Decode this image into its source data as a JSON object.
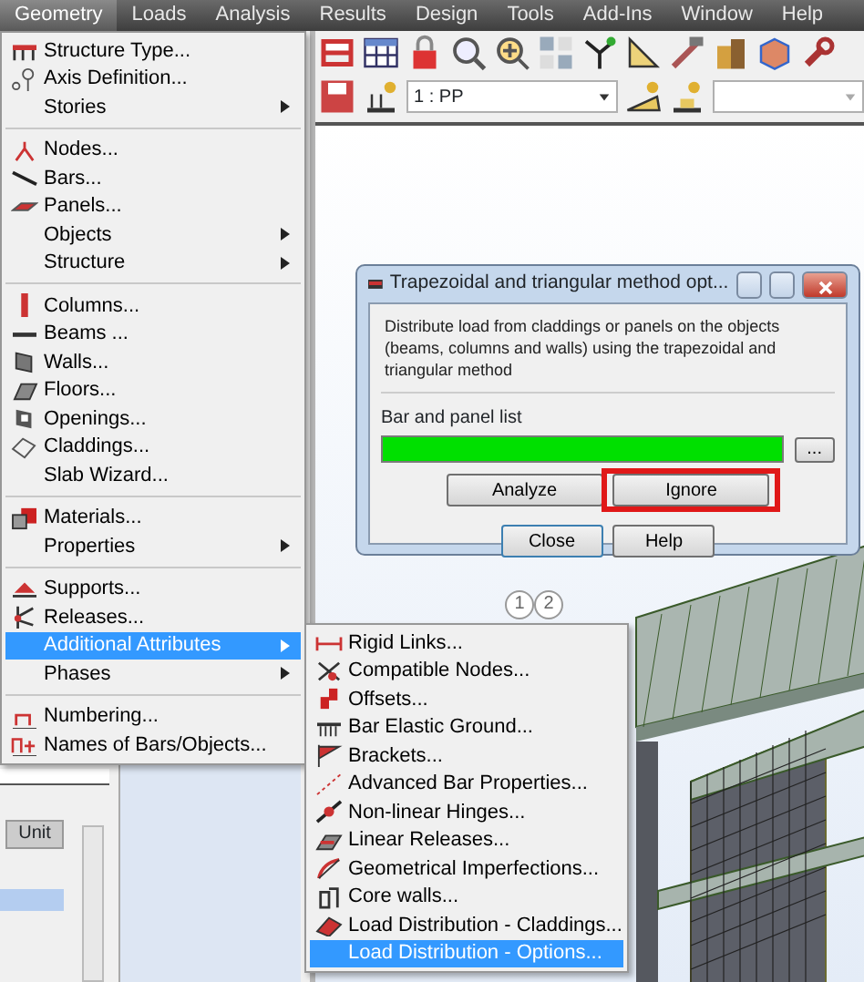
{
  "menubar": [
    {
      "label": "Geometry",
      "selected": true
    },
    {
      "label": "Loads",
      "selected": false
    },
    {
      "label": "Analysis",
      "selected": false
    },
    {
      "label": "Results",
      "selected": false
    },
    {
      "label": "Design",
      "selected": false
    },
    {
      "label": "Tools",
      "selected": false
    },
    {
      "label": "Add-Ins",
      "selected": false
    },
    {
      "label": "Window",
      "selected": false
    },
    {
      "label": "Help",
      "selected": false
    }
  ],
  "toolbar": {
    "case_select": {
      "value": "1 : PP"
    }
  },
  "grid_labels": [
    "1",
    "2"
  ],
  "bottom_panel": {
    "table": {
      "columns": [
        "Unit"
      ]
    }
  },
  "geometry_menu": {
    "items": [
      {
        "kind": "item",
        "label": "Structure Type...",
        "submenu": false,
        "selected": false
      },
      {
        "kind": "item",
        "label": "Axis Definition...",
        "submenu": false,
        "selected": false
      },
      {
        "kind": "item",
        "label": "Stories",
        "submenu": true,
        "selected": false
      },
      {
        "kind": "separator"
      },
      {
        "kind": "item",
        "label": "Nodes...",
        "submenu": false,
        "selected": false
      },
      {
        "kind": "item",
        "label": "Bars...",
        "submenu": false,
        "selected": false
      },
      {
        "kind": "item",
        "label": "Panels...",
        "submenu": false,
        "selected": false
      },
      {
        "kind": "item",
        "label": "Objects",
        "submenu": true,
        "selected": false
      },
      {
        "kind": "item",
        "label": "Structure",
        "submenu": true,
        "selected": false
      },
      {
        "kind": "separator"
      },
      {
        "kind": "item",
        "label": "Columns...",
        "submenu": false,
        "selected": false
      },
      {
        "kind": "item",
        "label": "Beams ...",
        "submenu": false,
        "selected": false
      },
      {
        "kind": "item",
        "label": "Walls...",
        "submenu": false,
        "selected": false
      },
      {
        "kind": "item",
        "label": "Floors...",
        "submenu": false,
        "selected": false
      },
      {
        "kind": "item",
        "label": "Openings...",
        "submenu": false,
        "selected": false
      },
      {
        "kind": "item",
        "label": "Claddings...",
        "submenu": false,
        "selected": false
      },
      {
        "kind": "item",
        "label": "Slab Wizard...",
        "submenu": false,
        "selected": false
      },
      {
        "kind": "separator"
      },
      {
        "kind": "item",
        "label": "Materials...",
        "submenu": false,
        "selected": false
      },
      {
        "kind": "item",
        "label": "Properties",
        "submenu": true,
        "selected": false
      },
      {
        "kind": "separator"
      },
      {
        "kind": "item",
        "label": "Supports...",
        "submenu": false,
        "selected": false
      },
      {
        "kind": "item",
        "label": "Releases...",
        "submenu": false,
        "selected": false
      },
      {
        "kind": "item",
        "label": "Additional Attributes",
        "submenu": true,
        "selected": true
      },
      {
        "kind": "item",
        "label": "Phases",
        "submenu": true,
        "selected": false
      },
      {
        "kind": "separator"
      },
      {
        "kind": "item",
        "label": "Numbering...",
        "submenu": false,
        "selected": false
      },
      {
        "kind": "item",
        "label": "Names of Bars/Objects...",
        "submenu": false,
        "selected": false
      }
    ]
  },
  "submenu": {
    "items": [
      {
        "label": "Rigid Links...",
        "selected": false
      },
      {
        "label": "Compatible Nodes...",
        "selected": false
      },
      {
        "label": "Offsets...",
        "selected": false
      },
      {
        "label": "Bar Elastic Ground...",
        "selected": false
      },
      {
        "label": "Brackets...",
        "selected": false
      },
      {
        "label": "Advanced Bar Properties...",
        "selected": false
      },
      {
        "label": "Non-linear Hinges...",
        "selected": false
      },
      {
        "label": "Linear Releases...",
        "selected": false
      },
      {
        "label": "Geometrical Imperfections...",
        "selected": false
      },
      {
        "label": "Core walls...",
        "selected": false
      },
      {
        "label": "Load Distribution - Claddings...",
        "selected": false
      },
      {
        "label": "Load Distribution - Options...",
        "selected": true
      }
    ]
  },
  "dialog": {
    "title": "Trapezoidal and triangular method opt...",
    "description": "Distribute load from claddings or panels on the objects (beams, columns and walls) using the trapezoidal and triangular method",
    "list_label": "Bar and panel list",
    "browse_button": "...",
    "buttons": [
      {
        "label": "Analyze",
        "highlighted": false
      },
      {
        "label": "Ignore",
        "highlighted": true
      }
    ],
    "footer_buttons": [
      {
        "label": "Close",
        "default": true
      },
      {
        "label": "Help",
        "default": false
      }
    ]
  }
}
